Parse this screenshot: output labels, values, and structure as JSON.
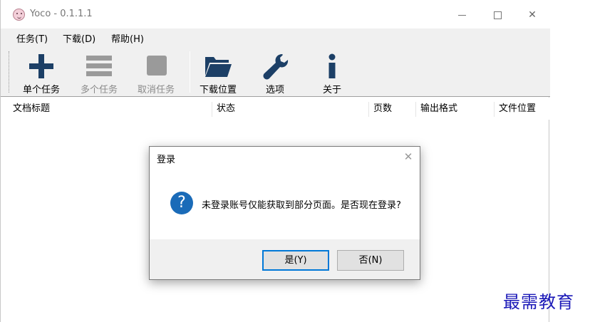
{
  "window": {
    "title": "Yoco - 0.1.1.1",
    "controls": {
      "minimize_icon": "minimize-icon",
      "maximize_icon": "maximize-icon",
      "close_glyph": "✕"
    }
  },
  "menu": {
    "task": "任务(T)",
    "download": "下载(D)",
    "help": "帮助(H)"
  },
  "toolbar": {
    "single_task": {
      "label": "单个任务",
      "icon": "plus-icon",
      "color": "#1c3f66"
    },
    "multi_task": {
      "label": "多个任务",
      "icon": "list-icon",
      "color": "#9a9a9a"
    },
    "cancel_task": {
      "label": "取消任务",
      "icon": "stop-icon",
      "color": "#9a9a9a"
    },
    "download_location": {
      "label": "下载位置",
      "icon": "folder-icon",
      "color": "#1c3f66"
    },
    "options": {
      "label": "选项",
      "icon": "wrench-icon",
      "color": "#1c3f66"
    },
    "about": {
      "label": "关于",
      "icon": "info-icon",
      "color": "#1c3f66"
    }
  },
  "list": {
    "columns": [
      "文档标题",
      "状态",
      "页数",
      "输出格式",
      "文件位置"
    ]
  },
  "dialog": {
    "title": "登录",
    "close_glyph": "✕",
    "icon": "question-icon",
    "icon_glyph": "?",
    "message": "未登录账号仅能获取到部分页面。是否现在登录?",
    "yes_label": "是(Y)",
    "no_label": "否(N)"
  },
  "watermark": "最需教育"
}
